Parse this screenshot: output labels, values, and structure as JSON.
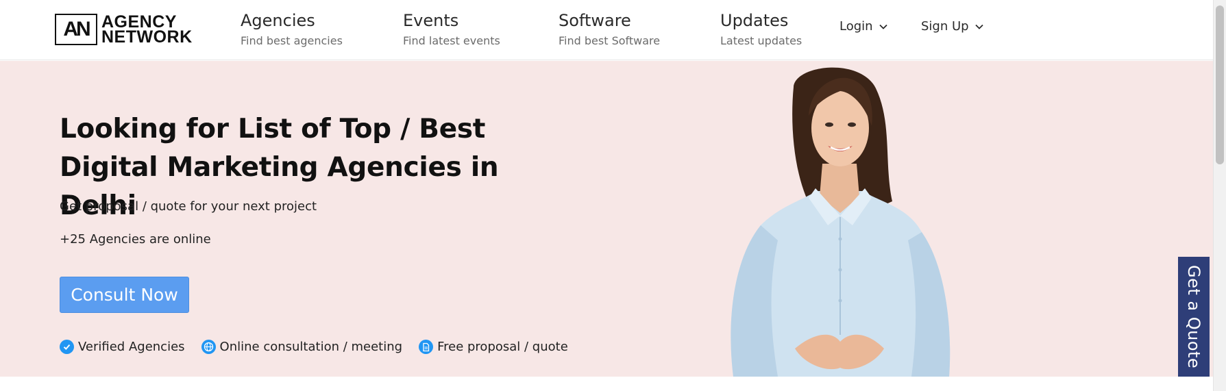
{
  "logo": {
    "mark": "AN",
    "line1": "AGENCY",
    "line2": "NETWORK"
  },
  "nav": {
    "items": [
      {
        "title": "Agencies",
        "subtitle": "Find best agencies"
      },
      {
        "title": "Events",
        "subtitle": "Find latest events"
      },
      {
        "title": "Software",
        "subtitle": "Find best Software"
      },
      {
        "title": "Updates",
        "subtitle": "Latest updates"
      }
    ],
    "login_label": "Login",
    "signup_label": "Sign Up"
  },
  "hero": {
    "title": "Looking for List of  Top / Best Digital Marketing Agencies in Delhi",
    "subtitle": "Get proposal / quote for your next project",
    "online_text": "+25 Agencies are online",
    "cta_label": "Consult Now",
    "features": [
      {
        "icon": "check-circle-icon",
        "label": "Verified Agencies"
      },
      {
        "icon": "globe-icon",
        "label": "Online consultation / meeting"
      },
      {
        "icon": "document-icon",
        "label": "Free proposal / quote"
      }
    ]
  },
  "side_tab": {
    "label": "Get a Quote"
  },
  "colors": {
    "hero_bg": "#f7e7e6",
    "cta_bg": "#5b9df0",
    "side_tab_bg": "#2e3e78",
    "feature_icon": "#2196f3"
  }
}
